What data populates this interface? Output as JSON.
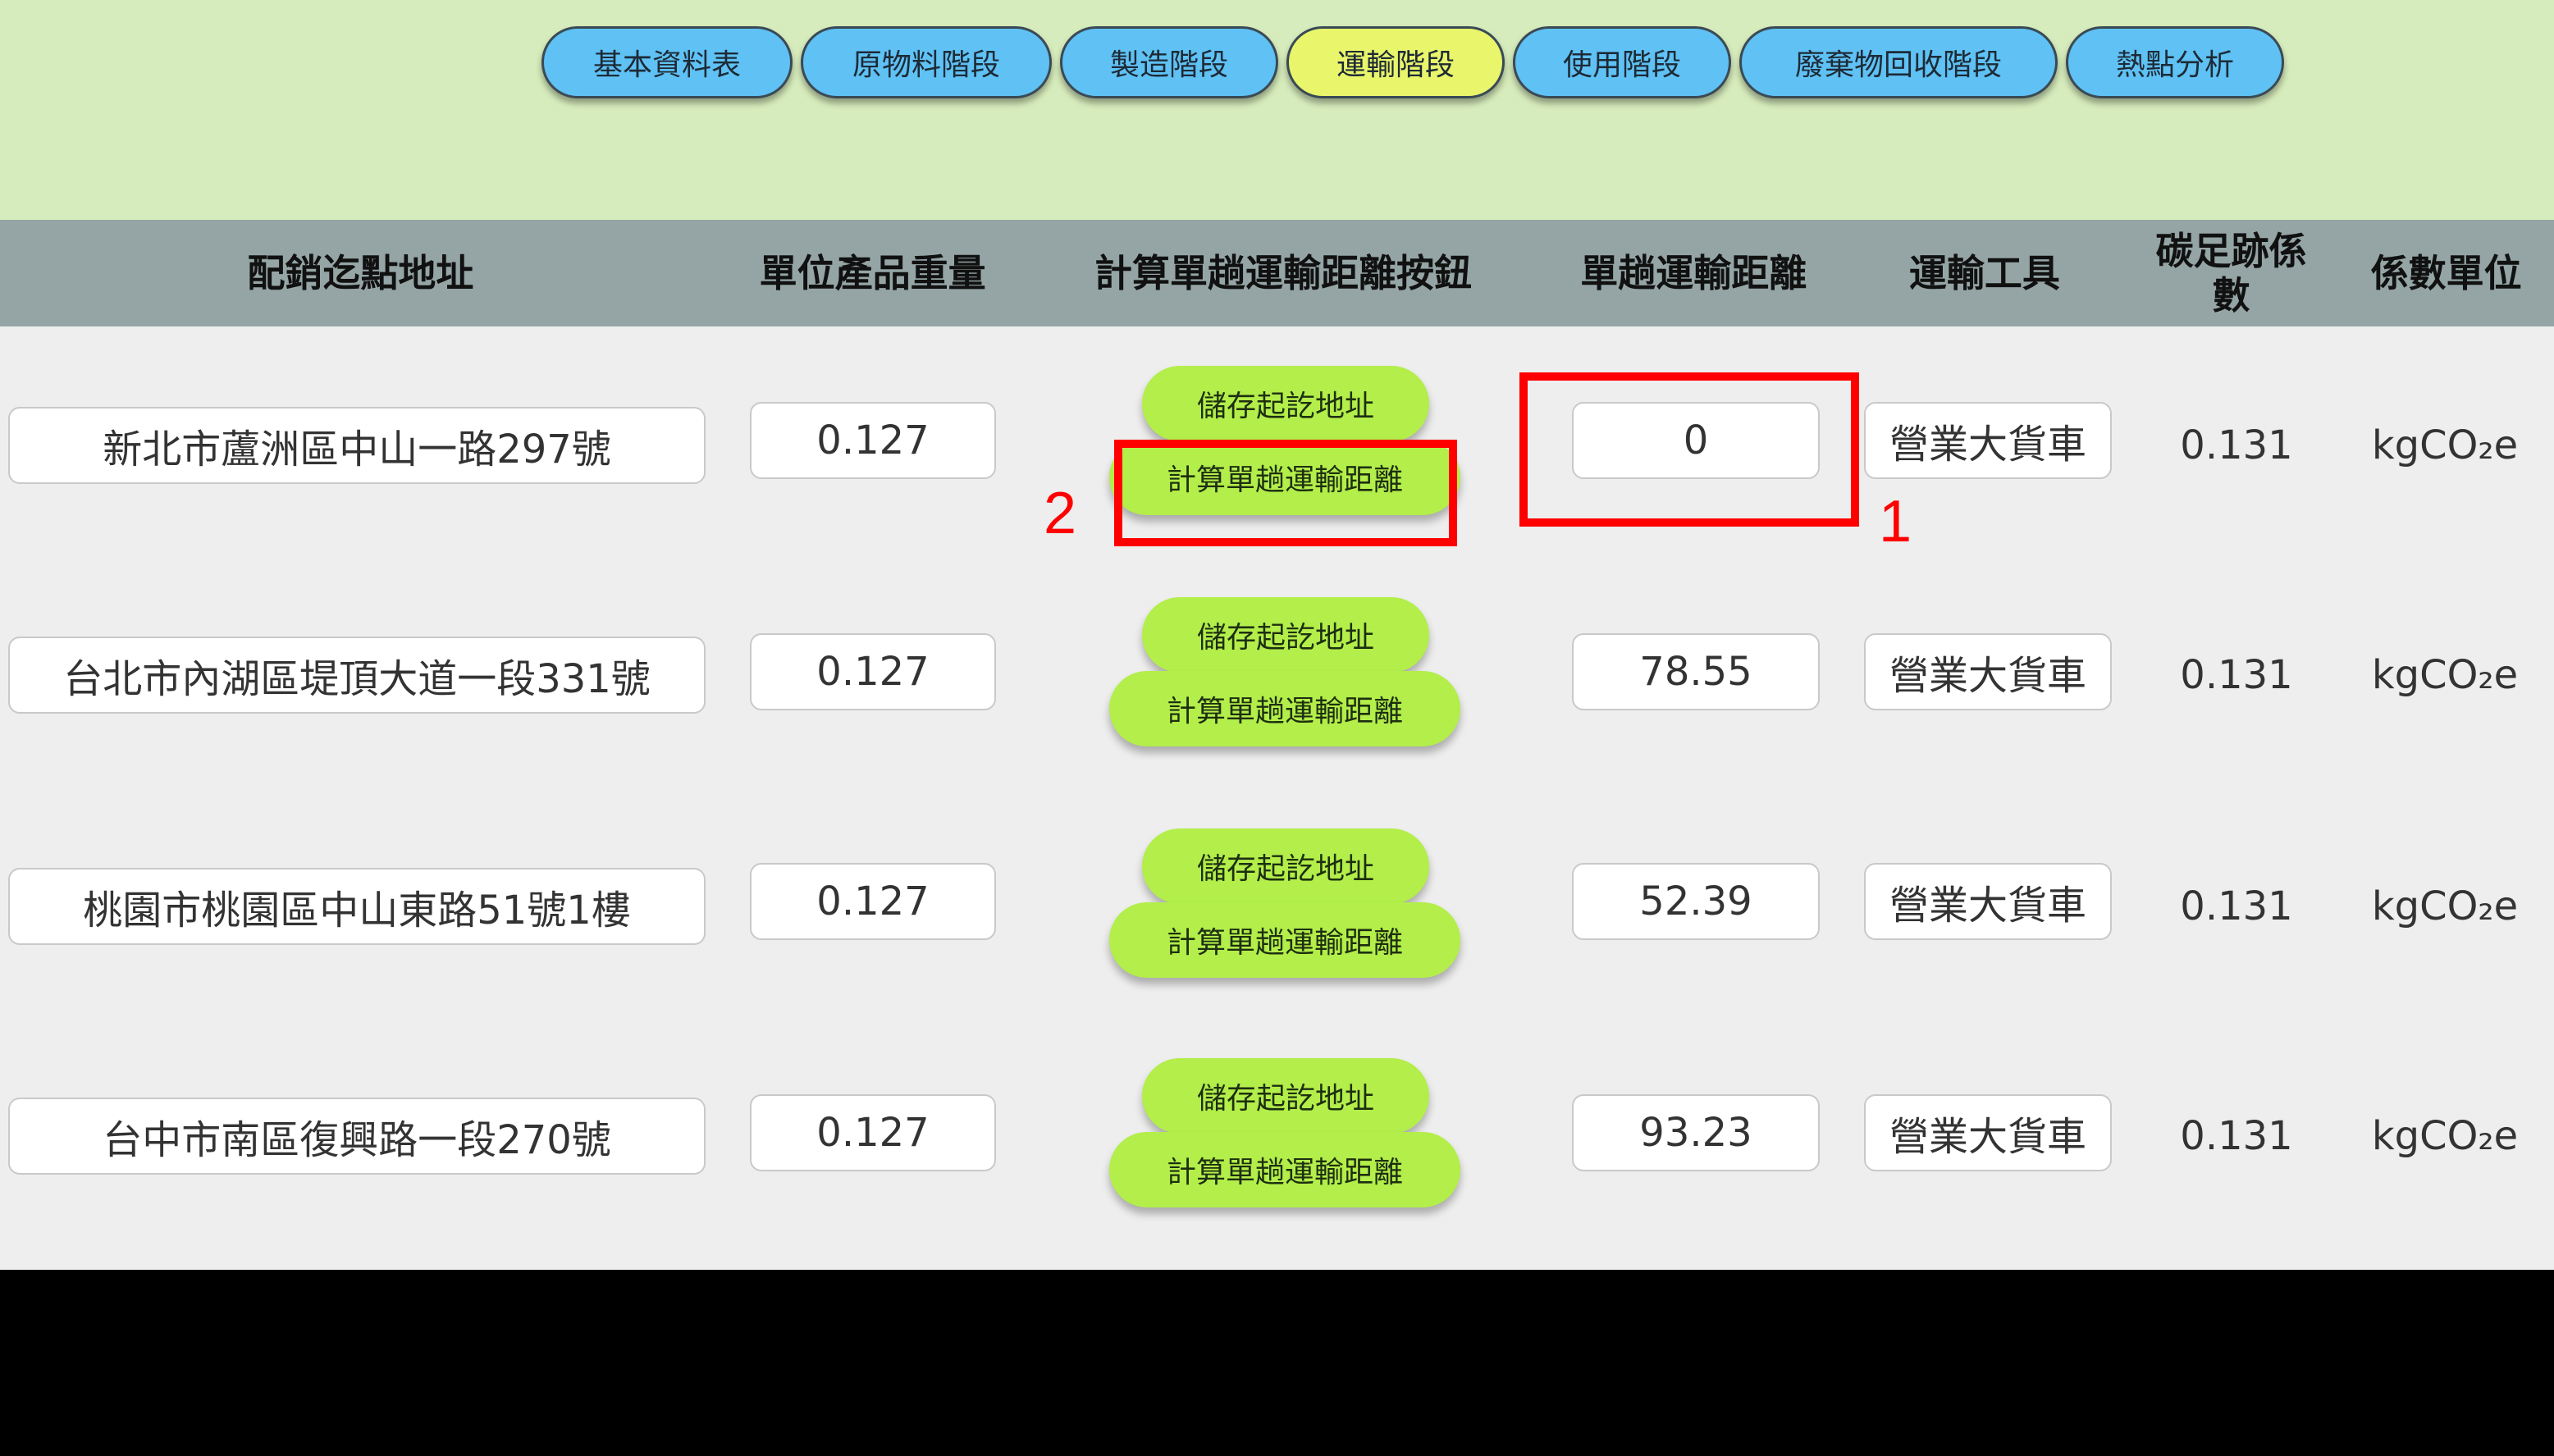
{
  "nav": {
    "tabs": [
      {
        "label": "基本資料表"
      },
      {
        "label": "原物料階段"
      },
      {
        "label": "製造階段"
      },
      {
        "label": "運輸階段"
      },
      {
        "label": "使用階段"
      },
      {
        "label": "廢棄物回收階段"
      },
      {
        "label": "熱點分析"
      }
    ],
    "active_index": 3
  },
  "table": {
    "headers": {
      "address": "配銷迄點地址",
      "weight": "單位產品重量",
      "calc_button": "計算單趟運輸距離按鈕",
      "distance": "單趟運輸距離",
      "vehicle": "運輸工具",
      "factor": "碳足跡係數",
      "unit": "係數單位"
    },
    "buttons": {
      "save": "儲存起訖地址",
      "calc": "計算單趟運輸距離"
    },
    "rows": [
      {
        "address": "新北市蘆洲區中山一路297號",
        "weight": "0.127",
        "distance": "0",
        "vehicle": "營業大貨車",
        "factor": "0.131",
        "unit": "kgCO₂e"
      },
      {
        "address": "台北市內湖區堤頂大道一段331號",
        "weight": "0.127",
        "distance": "78.55",
        "vehicle": "營業大貨車",
        "factor": "0.131",
        "unit": "kgCO₂e"
      },
      {
        "address": "桃園市桃園區中山東路51號1樓",
        "weight": "0.127",
        "distance": "52.39",
        "vehicle": "營業大貨車",
        "factor": "0.131",
        "unit": "kgCO₂e"
      },
      {
        "address": "台中市南區復興路一段270號",
        "weight": "0.127",
        "distance": "93.23",
        "vehicle": "營業大貨車",
        "factor": "0.131",
        "unit": "kgCO₂e"
      }
    ]
  },
  "annotations": {
    "mark_1": "1",
    "mark_2": "2"
  },
  "colors": {
    "nav_tab": "#5fc1f4",
    "nav_tab_active": "#e9f56b",
    "header_band": "#d7ecbc",
    "table_header": "#95a5a6",
    "green_button": "#b3ee4a",
    "highlight": "#ff0000"
  }
}
